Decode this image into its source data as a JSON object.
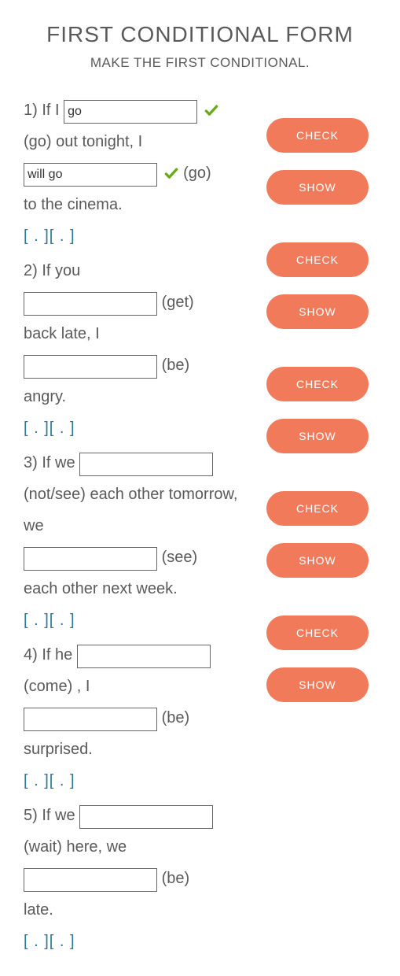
{
  "title": "FIRST CONDITIONAL FORM",
  "subtitle": "MAKE THE FIRST CONDITIONAL.",
  "buttons": {
    "check": "CHECK",
    "show": "SHOW"
  },
  "bracket_marker": "[ . ][ . ]",
  "questions": [
    {
      "num": "1)",
      "part1a": "If I",
      "input1": "go",
      "correct1": true,
      "hint1": "(go)",
      "part1b": "out tonight, I",
      "input2": "will go",
      "correct2": true,
      "hint2": "(go)",
      "part2": "to the cinema."
    },
    {
      "num": "2)",
      "part1a": "If you",
      "input1": "",
      "correct1": false,
      "hint1": "(get)",
      "part1b": "back late, I",
      "input2": "",
      "correct2": false,
      "hint2": "(be)",
      "part2": "angry."
    },
    {
      "num": "3)",
      "part1a": "If we",
      "input1": "",
      "correct1": false,
      "hint1": "(not/see)",
      "part1b": "each other tomorrow, we",
      "input2": "",
      "correct2": false,
      "hint2": "(see)",
      "part2": "each other next week."
    },
    {
      "num": "4)",
      "part1a": "If he",
      "input1": "",
      "correct1": false,
      "hint1": "(come)",
      "part1b": ", I",
      "input2": "",
      "correct2": false,
      "hint2": "(be)",
      "part2": "surprised."
    },
    {
      "num": "5)",
      "part1a": "If we",
      "input1": "",
      "correct1": false,
      "hint1": "(wait)",
      "part1b": "here, we",
      "input2": "",
      "correct2": false,
      "hint2": "(be)",
      "part2": "late."
    }
  ]
}
